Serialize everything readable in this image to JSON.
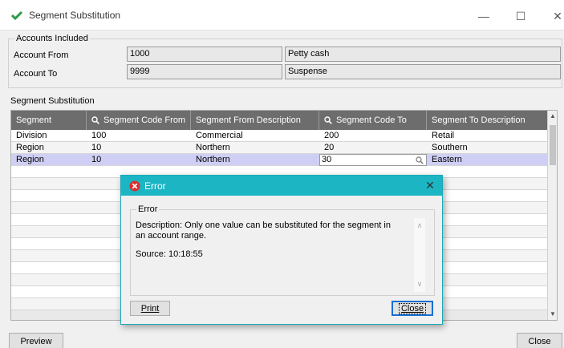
{
  "window": {
    "title": "Segment Substitution",
    "minimize": "—",
    "maximize": "☐",
    "close": "✕"
  },
  "accounts": {
    "group_label": "Accounts Included",
    "from_label": "Account From",
    "from_value": "1000",
    "from_desc": "Petty cash",
    "to_label": "Account To",
    "to_value": "9999",
    "to_desc": "Suspense"
  },
  "grid": {
    "section_label": "Segment Substitution",
    "columns": [
      "Segment",
      "Segment Code From",
      "Segment From Description",
      "Segment Code To",
      "Segment To Description"
    ],
    "rows": [
      [
        "Division",
        "100",
        "Commercial",
        "200",
        "Retail"
      ],
      [
        "Region",
        "10",
        "Northern",
        "20",
        "Southern"
      ],
      [
        "Region",
        "10",
        "Northern",
        "30",
        "Eastern"
      ]
    ]
  },
  "buttons": {
    "preview": "Preview",
    "close": "Close"
  },
  "dialog": {
    "title": "Error",
    "group_label": "Error",
    "description": "Description: Only one value can be substituted for the segment in an account range.",
    "source": "Source:  10:18:55",
    "print": "Print",
    "close": "Close",
    "close_x": "✕"
  },
  "colors": {
    "dialog_title": "#1bb5c4",
    "grid_header": "#6d6d6d",
    "selected_row": "#cfcff5",
    "error_icon": "#d9302c",
    "app_icon": "#2e9c4a"
  }
}
